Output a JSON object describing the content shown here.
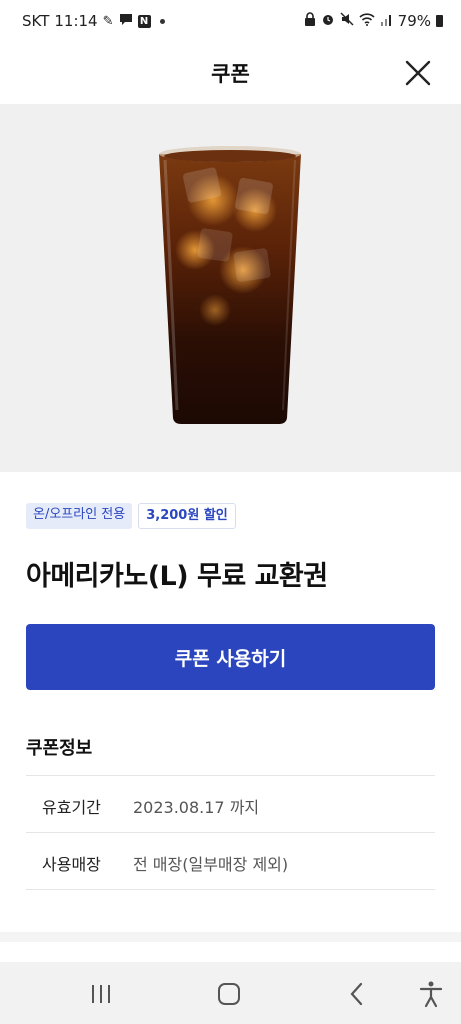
{
  "status_bar": {
    "carrier": "SKT",
    "time": "11:14",
    "battery": "79%",
    "left_icons": [
      "pen-icon",
      "chat-bubble-icon",
      "n-app-icon",
      "dot-icon"
    ],
    "right_icons": [
      "lock-icon",
      "alarm-icon",
      "mute-icon",
      "wifi-icon",
      "signal-icon",
      "battery-icon"
    ]
  },
  "header": {
    "title": "쿠폰",
    "close_icon": "close-icon"
  },
  "hero": {
    "image": "iced-americano-cup"
  },
  "badges": {
    "channel": "온/오프라인 전용",
    "discount": "3,200원 할인"
  },
  "product": {
    "title": "아메리카노(L) 무료 교환권"
  },
  "actions": {
    "use_label": "쿠폰 사용하기"
  },
  "coupon_info": {
    "heading": "쿠폰정보",
    "rows": [
      {
        "label": "유효기간",
        "value": "2023.08.17 까지"
      },
      {
        "label": "사용매장",
        "value": "전 매장(일부매장 제외)"
      }
    ]
  },
  "nav": {
    "items": [
      "recent-apps-icon",
      "home-icon",
      "back-icon",
      "accessibility-icon"
    ]
  },
  "colors": {
    "accent": "#2a45be",
    "badge_bg": "#e6ebf9",
    "hero_bg": "#f0f0f0"
  }
}
